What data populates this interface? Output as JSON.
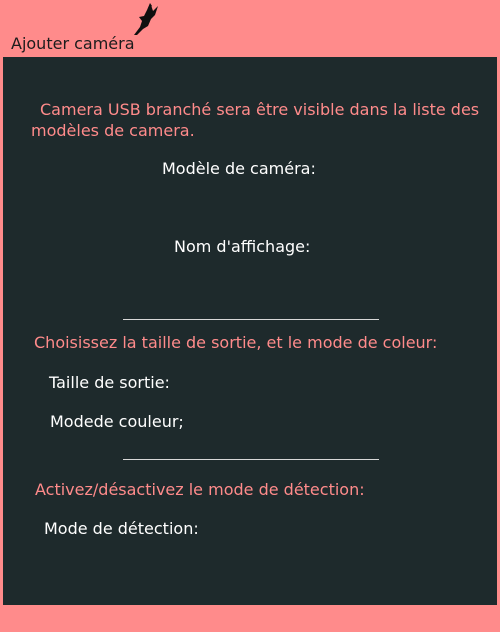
{
  "window": {
    "title": "Ajouter caméra",
    "logo_icon": "bird-icon"
  },
  "colors": {
    "accent": "#ff8b8b",
    "panel_background": "#1e2a2c",
    "label_text": "#ffffff"
  },
  "camera_section": {
    "intro": "Camera USB branché sera être visible dans la liste des modèles de camera.",
    "model_label": "Modèle de caméra:",
    "display_name_label": "Nom d'affichage:"
  },
  "output_section": {
    "heading": "Choisissez la taille de sortie, et le mode de coleur:",
    "output_size_label": "Taille de sortie:",
    "color_mode_label": "Modede couleur;"
  },
  "detection_section": {
    "heading": "Activez/désactivez le mode de détection:",
    "detection_mode_label": "Mode de détection:"
  }
}
